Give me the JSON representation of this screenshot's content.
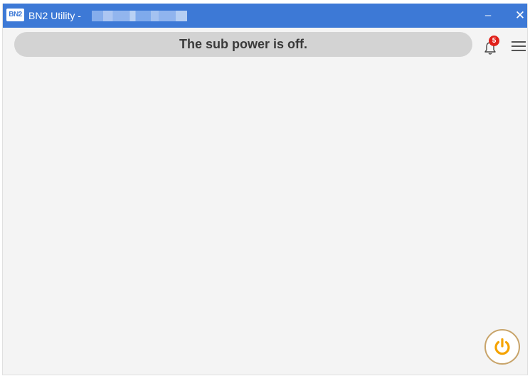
{
  "window": {
    "logo_text": "BN2",
    "title": "BN2 Utility -",
    "minimize_glyph": "–",
    "close_glyph": "✕"
  },
  "status": {
    "message": "The sub power is off."
  },
  "notifications": {
    "count": "5",
    "icon": "bell-icon"
  },
  "menu": {
    "icon": "hamburger-menu-icon"
  },
  "power": {
    "icon": "power-icon",
    "color": "#f5a300"
  },
  "colors": {
    "titlebar": "#3d79d6",
    "background": "#f4f4f4",
    "badge": "#e0201a",
    "status_pill": "#d3d3d3"
  }
}
